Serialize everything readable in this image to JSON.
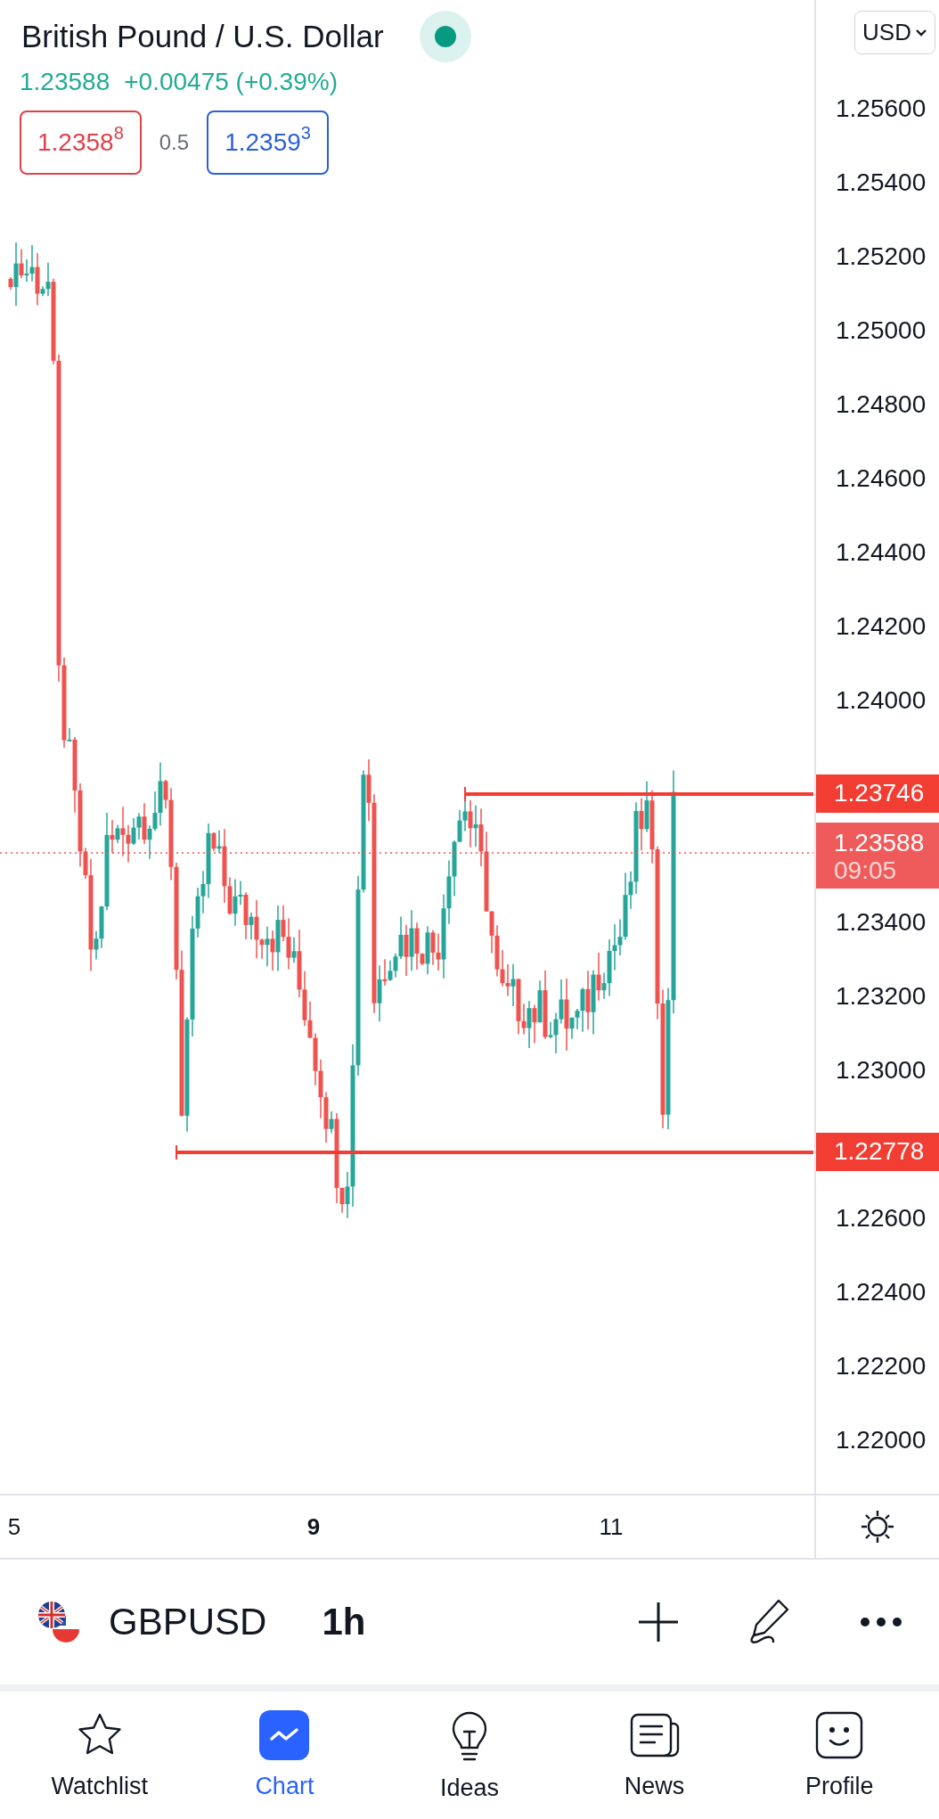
{
  "header": {
    "title": "British Pound / U.S. Dollar",
    "market_open": true,
    "last": "1.23588",
    "change": "+0.00475 (+0.39%)",
    "bid": {
      "price": "1.2358",
      "pip": "8"
    },
    "spread": "0.5",
    "ask": {
      "price": "1.2359",
      "pip": "3"
    }
  },
  "currency": "USD",
  "price_axis": {
    "ticks": [
      "1.25600",
      "1.25400",
      "1.25200",
      "1.25000",
      "1.24800",
      "1.24600",
      "1.24400",
      "1.24200",
      "1.24000",
      "1.23400",
      "1.23200",
      "1.23000",
      "1.22600",
      "1.22400",
      "1.22200",
      "1.22000"
    ]
  },
  "levels": [
    {
      "kind": "line",
      "label": "1.23746"
    },
    {
      "kind": "current",
      "label": "1.23588",
      "countdown": "09:05"
    },
    {
      "kind": "line",
      "label": "1.22778"
    }
  ],
  "time_axis": [
    {
      "label": "5",
      "major": false
    },
    {
      "label": "9",
      "major": true
    },
    {
      "label": "11",
      "major": false
    }
  ],
  "toolbar": {
    "symbol": "GBPUSD",
    "interval": "1h"
  },
  "nav": [
    {
      "label": "Watchlist",
      "selected": false
    },
    {
      "label": "Chart",
      "selected": true
    },
    {
      "label": "Ideas",
      "selected": false
    },
    {
      "label": "News",
      "selected": false
    },
    {
      "label": "Profile",
      "selected": false
    }
  ]
}
